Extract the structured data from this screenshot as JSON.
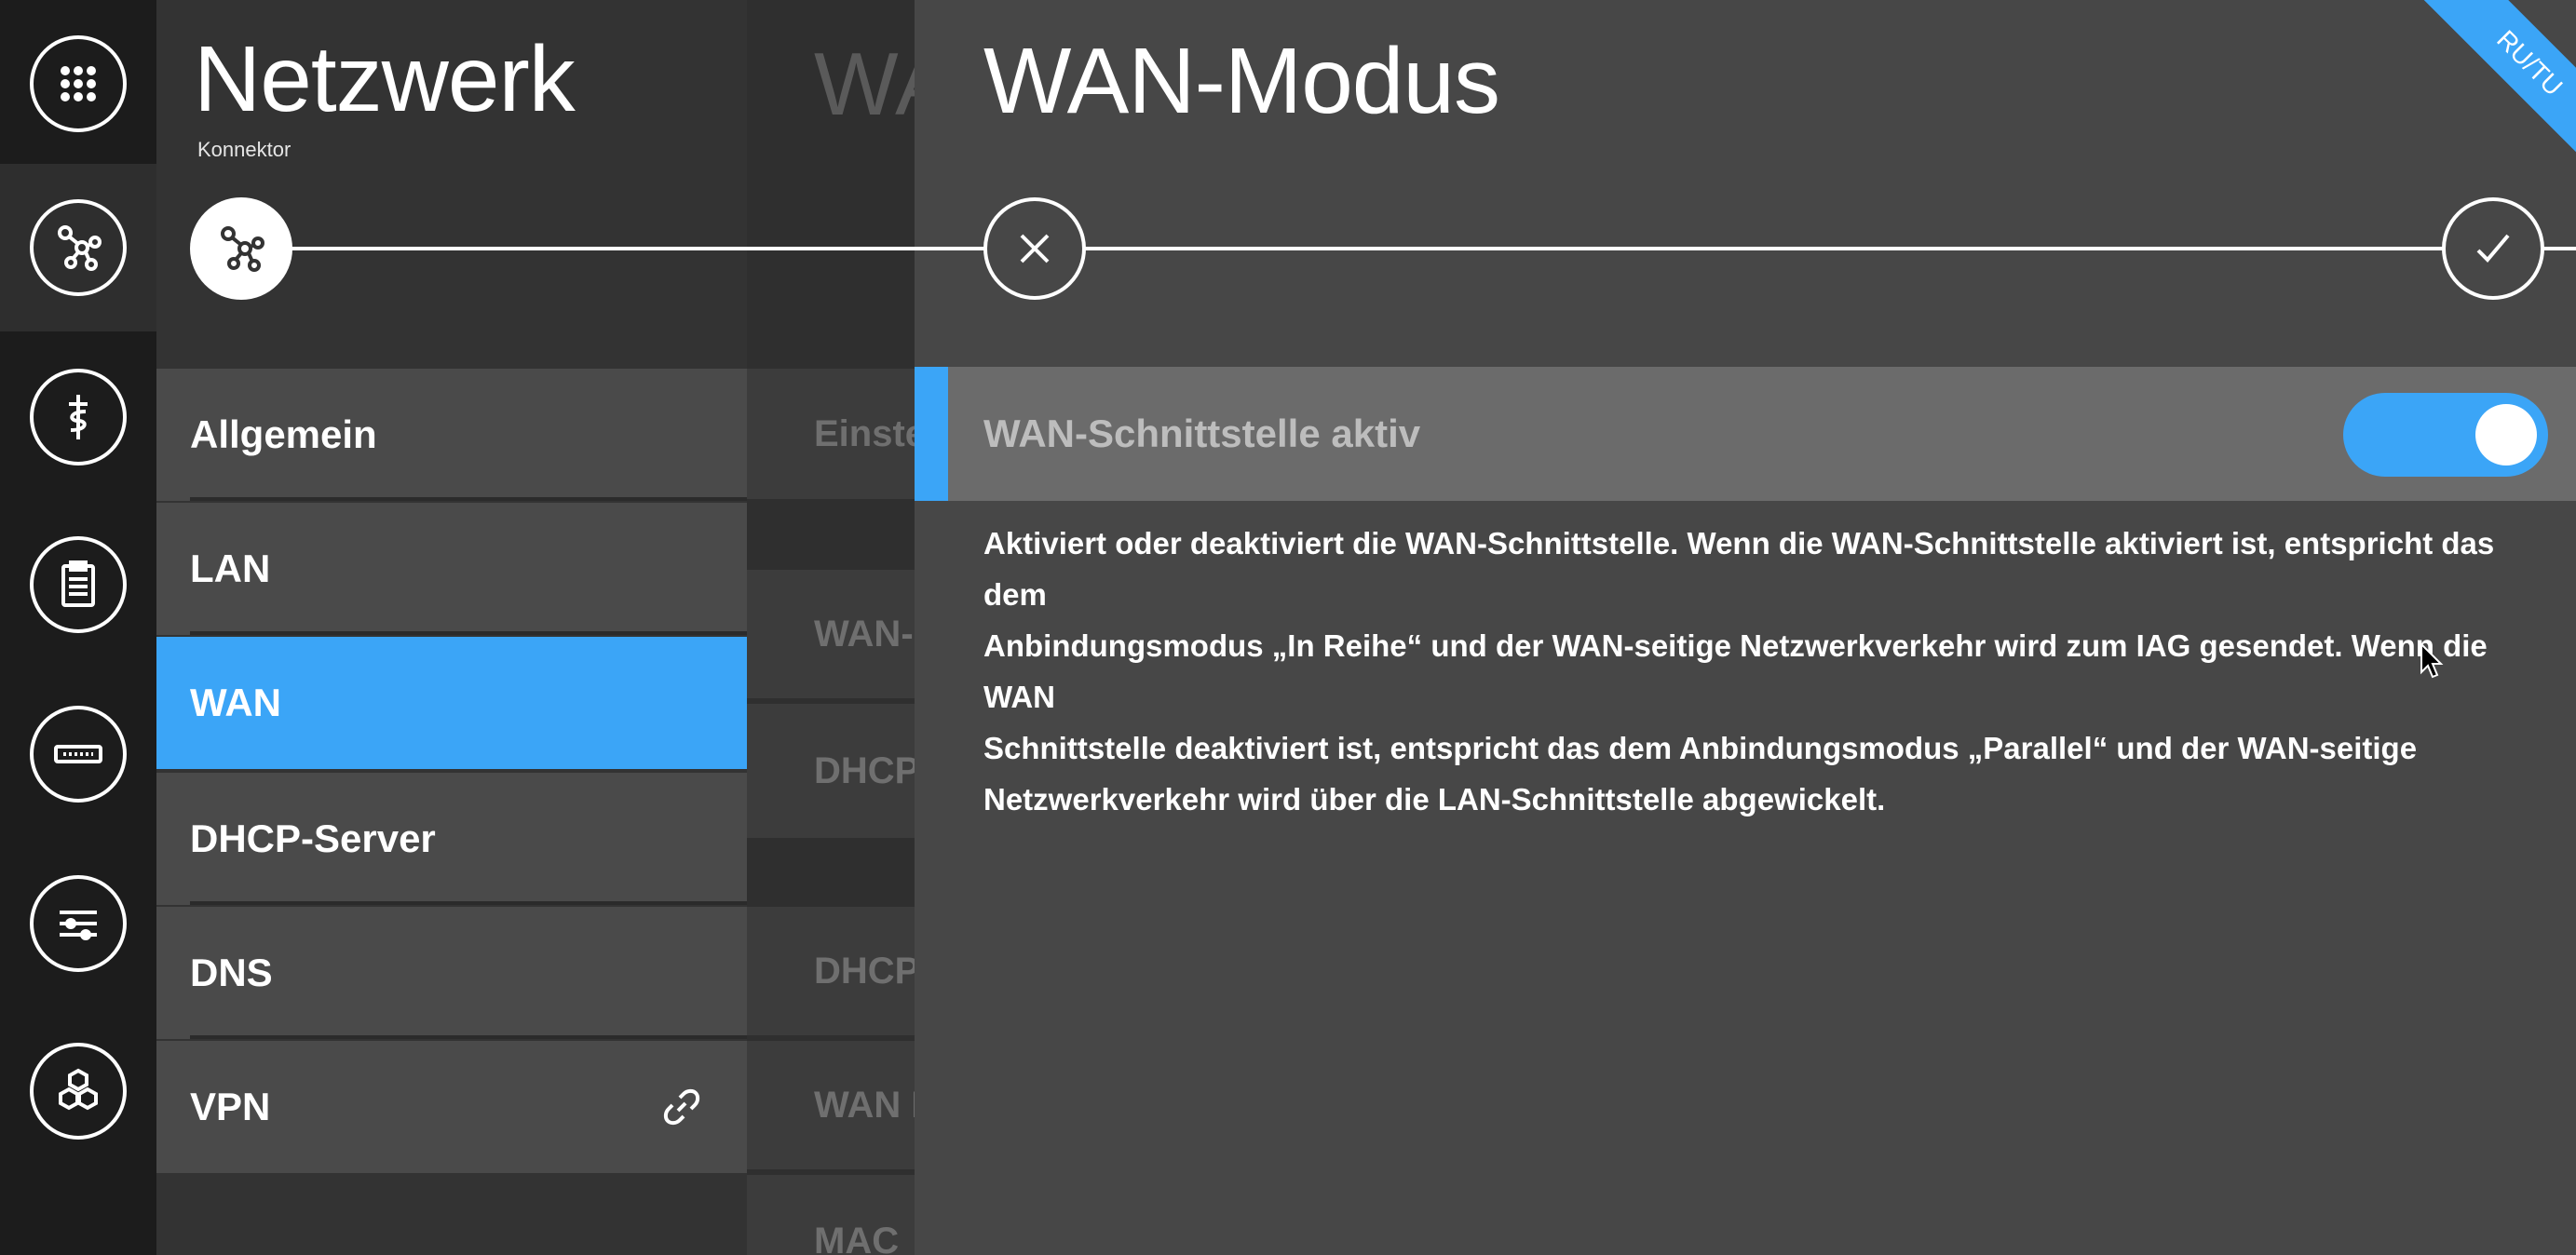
{
  "rail": {
    "items": [
      {
        "icon": "apps-grid-icon"
      },
      {
        "icon": "network-icon",
        "active": true
      },
      {
        "icon": "medical-caduceus-icon"
      },
      {
        "icon": "clipboard-icon"
      },
      {
        "icon": "device-card-icon"
      },
      {
        "icon": "transfer-arrows-icon"
      },
      {
        "icon": "hexagons-icon"
      }
    ]
  },
  "col1": {
    "title": "Netzwerk",
    "subtitle": "Konnektor",
    "nav": [
      {
        "label": "Allgemein"
      },
      {
        "label": "LAN"
      },
      {
        "label": "WAN",
        "active": true
      },
      {
        "label": "DHCP-Server"
      },
      {
        "label": "DNS"
      },
      {
        "label": "VPN",
        "icon": "link-icon"
      }
    ]
  },
  "col2": {
    "title": "WA",
    "rows": [
      "Einste",
      "WAN-I",
      "DHCP",
      "DHCP",
      "WAN I",
      "MAC"
    ]
  },
  "panel": {
    "title": "WAN-Modus",
    "ribbon": "RU/TU",
    "toggle_label": "WAN-Schnittstelle aktiv",
    "toggle_on": true,
    "description_lines": [
      "Aktiviert oder deaktiviert die WAN-Schnittstelle. Wenn die WAN-Schnittstelle aktiviert ist, entspricht das dem",
      "Anbindungsmodus „In Reihe“ und der WAN-seitige Netzwerkverkehr wird zum IAG gesendet. Wenn die WAN",
      "Schnittstelle deaktiviert ist, entspricht das dem Anbindungsmodus „Parallel“ und der WAN-seitige",
      "Netzwerkverkehr wird über die LAN-Schnittstelle abgewickelt."
    ]
  },
  "colors": {
    "accent": "#3ba5f7",
    "rail": "#1c1c1c",
    "panel": "#474747"
  }
}
